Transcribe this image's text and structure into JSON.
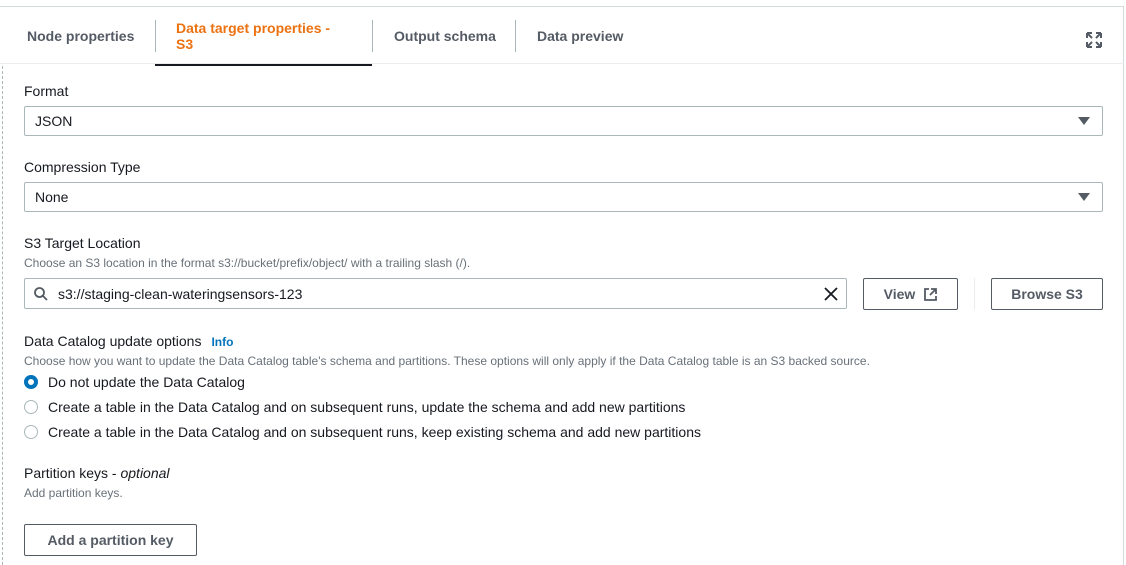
{
  "tabs": [
    {
      "label": "Node properties"
    },
    {
      "label": "Data target properties - S3"
    },
    {
      "label": "Output schema"
    },
    {
      "label": "Data preview"
    }
  ],
  "format": {
    "label": "Format",
    "value": "JSON"
  },
  "compression": {
    "label": "Compression Type",
    "value": "None"
  },
  "s3_target": {
    "label": "S3 Target Location",
    "description": "Choose an S3 location in the format s3://bucket/prefix/object/ with a trailing slash (/).",
    "value": "s3://staging-clean-wateringsensors-123",
    "view_label": "View",
    "browse_label": "Browse S3"
  },
  "catalog": {
    "label": "Data Catalog update options",
    "info_label": "Info",
    "description": "Choose how you want to update the Data Catalog table's schema and partitions. These options will only apply if the Data Catalog table is an S3 backed source.",
    "options": [
      {
        "label": "Do not update the Data Catalog",
        "selected": true
      },
      {
        "label": "Create a table in the Data Catalog and on subsequent runs, update the schema and add new partitions",
        "selected": false
      },
      {
        "label": "Create a table in the Data Catalog and on subsequent runs, keep existing schema and add new partitions",
        "selected": false
      }
    ]
  },
  "partition": {
    "label": "Partition keys - ",
    "label_optional": "optional",
    "description": "Add partition keys.",
    "add_label": "Add a partition key"
  },
  "colors": {
    "accent": "#ec7211",
    "link": "#0073bb"
  }
}
